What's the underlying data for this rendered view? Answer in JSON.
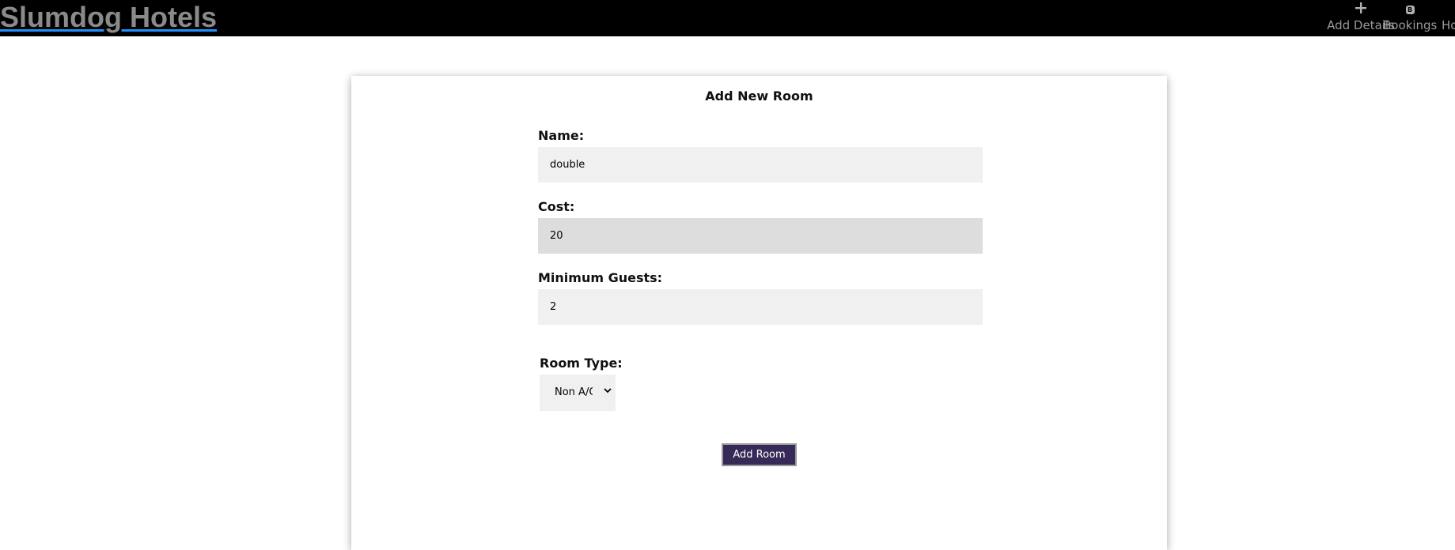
{
  "navbar": {
    "brand": "Slumdog Hotels",
    "items": [
      {
        "label": "Add Details",
        "icon": "plus-icon"
      },
      {
        "label": "Bookings",
        "icon": "bookings-icon"
      },
      {
        "label": "Ho",
        "icon": "home-icon"
      }
    ]
  },
  "form": {
    "title": "Add New Room",
    "name_label": "Name:",
    "name_value": "double",
    "cost_label": "Cost:",
    "cost_value": "20",
    "guests_label": "Minimum Guests:",
    "guests_value": "2",
    "room_type_label": "Room Type:",
    "room_type_value": "Non A/C",
    "submit_label": "Add Room"
  },
  "colors": {
    "navbar_bg": "#000000",
    "brand_text": "#8a8a8a",
    "brand_underline": "#1e90ff",
    "button_bg": "#372a58",
    "input_bg": "#f0f0f0",
    "input_hover_bg": "#dddddd"
  }
}
